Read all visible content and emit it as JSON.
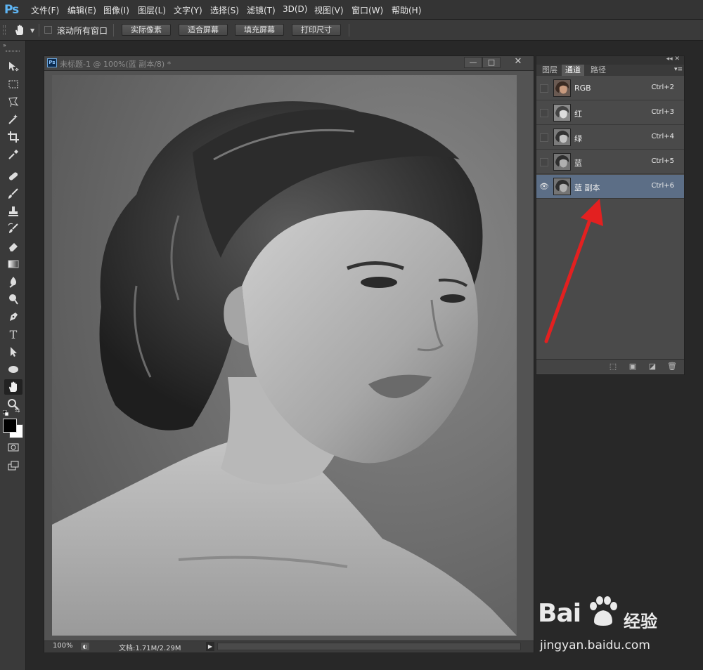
{
  "app": {
    "logo": "Ps",
    "menus": [
      "文件(F)",
      "编辑(E)",
      "图像(I)",
      "图层(L)",
      "文字(Y)",
      "选择(S)",
      "滤镜(T)",
      "3D(D)",
      "视图(V)",
      "窗口(W)",
      "帮助(H)"
    ]
  },
  "options": {
    "scroll_all_label": "滚动所有窗口",
    "buttons": [
      "实际像素",
      "适合屏幕",
      "填充屏幕",
      "打印尺寸"
    ]
  },
  "document": {
    "title": "未标题-1 @ 100%(蓝 副本/8) *",
    "zoom": "100%",
    "doc_size": "文档:1.71M/2.29M"
  },
  "panel": {
    "tabs": [
      "图层",
      "通道",
      "路径"
    ],
    "active_tab": "通道",
    "channels": [
      {
        "name": "RGB",
        "shortcut": "Ctrl+2"
      },
      {
        "name": "红",
        "shortcut": "Ctrl+3"
      },
      {
        "name": "绿",
        "shortcut": "Ctrl+4"
      },
      {
        "name": "蓝",
        "shortcut": "Ctrl+5"
      },
      {
        "name": "蓝 副本",
        "shortcut": "Ctrl+6"
      }
    ],
    "selected_channel": "蓝 副本"
  },
  "watermark": {
    "brand": "Bai",
    "brand_cn": "经验",
    "url": "jingyan.baidu.com"
  },
  "colors": {
    "accent_arrow": "#e32020",
    "selected_row": "#5c6e86",
    "ps_logo": "#5fb6f5"
  },
  "icons": {
    "tools": [
      "move-icon",
      "marquee-icon",
      "lasso-icon",
      "magic-wand-icon",
      "crop-icon",
      "eyedropper-icon",
      "healing-brush-icon",
      "brush-icon",
      "clone-stamp-icon",
      "history-brush-icon",
      "eraser-icon",
      "gradient-icon",
      "blur-icon",
      "dodge-icon",
      "pen-icon",
      "type-icon",
      "path-selection-icon",
      "shape-icon",
      "hand-icon",
      "zoom-icon"
    ]
  }
}
